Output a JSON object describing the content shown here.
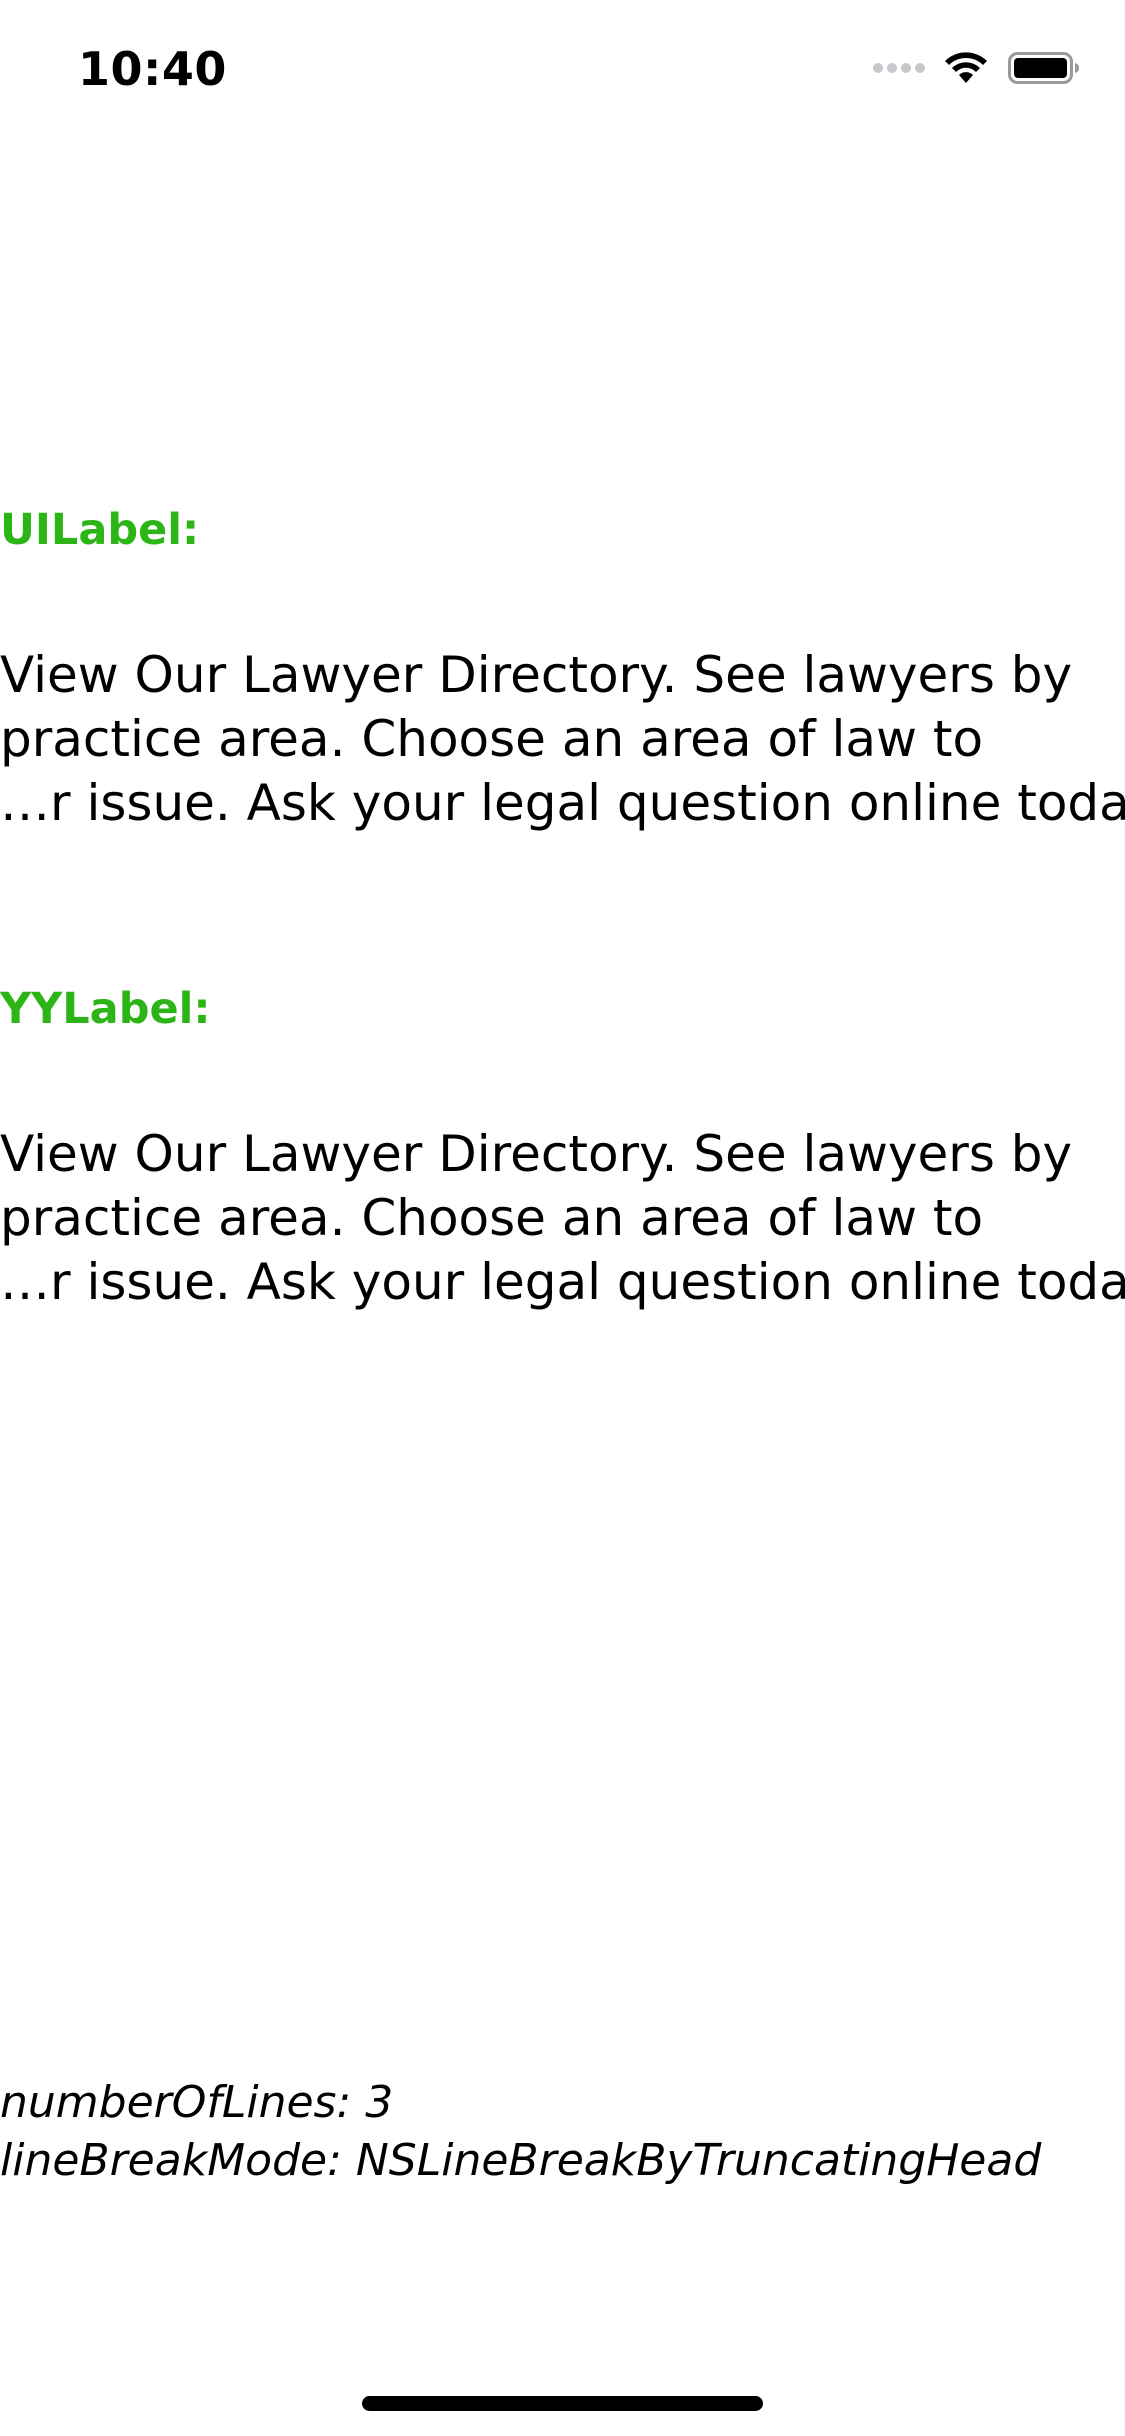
{
  "status_bar": {
    "time": "10:40",
    "icons": [
      "signal-dots-icon",
      "wifi-icon",
      "battery-icon"
    ]
  },
  "uilabel_section": {
    "title": "UILabel:",
    "lines": [
      "View Our Lawyer Directory. See lawyers by",
      "practice area. Choose an area of law to",
      "…r issue. Ask your legal question online today!"
    ]
  },
  "yylabel_section": {
    "title": "YYLabel:",
    "lines": [
      "View Our Lawyer Directory. See lawyers by",
      "practice area. Choose an area of law to",
      "…r issue. Ask your legal question online today!"
    ]
  },
  "footer": {
    "number_of_lines": "numberOfLines: 3",
    "line_break_mode": "lineBreakMode: NSLineBreakByTruncatingHead"
  },
  "colors": {
    "title_green": "#2db518",
    "text": "#000000",
    "background": "#ffffff"
  }
}
